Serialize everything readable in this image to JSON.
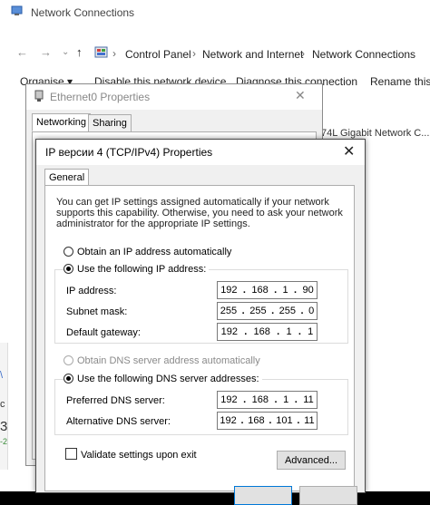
{
  "explorer": {
    "title": "Network Connections",
    "breadcrumb": [
      "Control Panel",
      "Network and Internet",
      "Network Connections"
    ],
    "commands": [
      "Organise ▾",
      "Disable this network device",
      "Diagnose this connection",
      "Rename this"
    ],
    "adapter_partial": "74L Gigabit Network C..."
  },
  "ethernet_props": {
    "title": "Ethernet0 Properties",
    "tabs": [
      "Networking",
      "Sharing"
    ]
  },
  "ipv4": {
    "title": "IP версии 4 (TCP/IPv4) Properties",
    "tab": "General",
    "description": "You can get IP settings assigned automatically if your network supports this capability. Otherwise, you need to ask your network administrator for the appropriate IP settings.",
    "radio_auto_ip": "Obtain an IP address automatically",
    "radio_manual_ip": "Use the following IP address:",
    "ip_label": "IP address:",
    "ip_value": [
      "192",
      "168",
      "1",
      "90"
    ],
    "mask_label": "Subnet mask:",
    "mask_value": [
      "255",
      "255",
      "255",
      "0"
    ],
    "gateway_label": "Default gateway:",
    "gateway_value": [
      "192",
      "168",
      "1",
      "1"
    ],
    "radio_auto_dns": "Obtain DNS server address automatically",
    "radio_manual_dns": "Use the following DNS server addresses:",
    "pref_dns_label": "Preferred DNS server:",
    "pref_dns_value": [
      "192",
      "168",
      "1",
      "11"
    ],
    "alt_dns_label": "Alternative DNS server:",
    "alt_dns_value": [
      "192",
      "168",
      "101",
      "11"
    ],
    "validate_label": "Validate settings upon exit",
    "advanced_label": "Advanced..."
  }
}
